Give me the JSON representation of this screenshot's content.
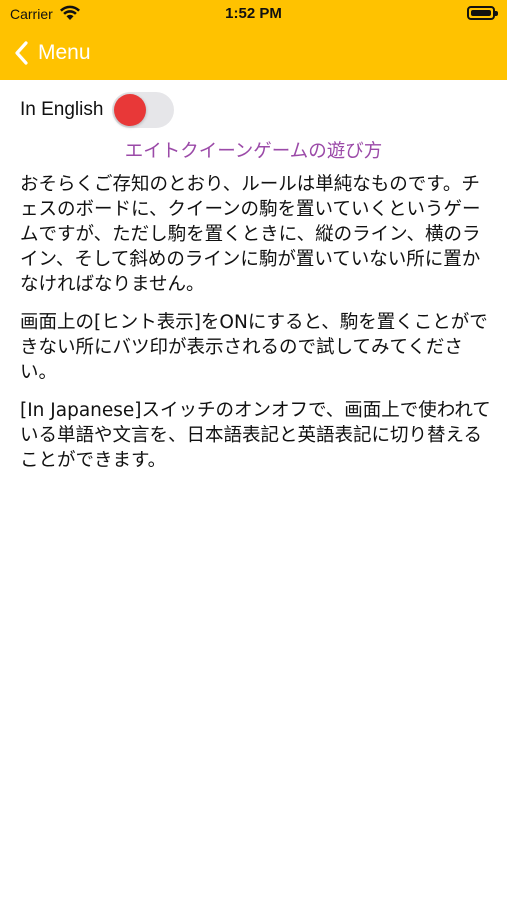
{
  "status_bar": {
    "carrier": "Carrier",
    "time": "1:52 PM"
  },
  "nav": {
    "back_label": "Menu",
    "background_color": "#FFC200"
  },
  "language_toggle": {
    "label": "In English",
    "is_on": false,
    "knob_color": "#e83838"
  },
  "title": "エイトクイーンゲームの遊び方",
  "paragraphs": [
    "おそらくご存知のとおり、ルールは単純なものです。チェスのボードに、クイーンの駒を置いていくというゲームですが、ただし駒を置くときに、縦のライン、横のライン、そして斜めのラインに駒が置いていない所に置かなければなりません。",
    "画面上の[ヒント表示]をONにすると、駒を置くことができない所にバツ印が表示されるので試してみてください。",
    "[In Japanese]スイッチのオンオフで、画面上で使われている単語や文言を、日本語表記と英語表記に切り替えることができます。"
  ]
}
